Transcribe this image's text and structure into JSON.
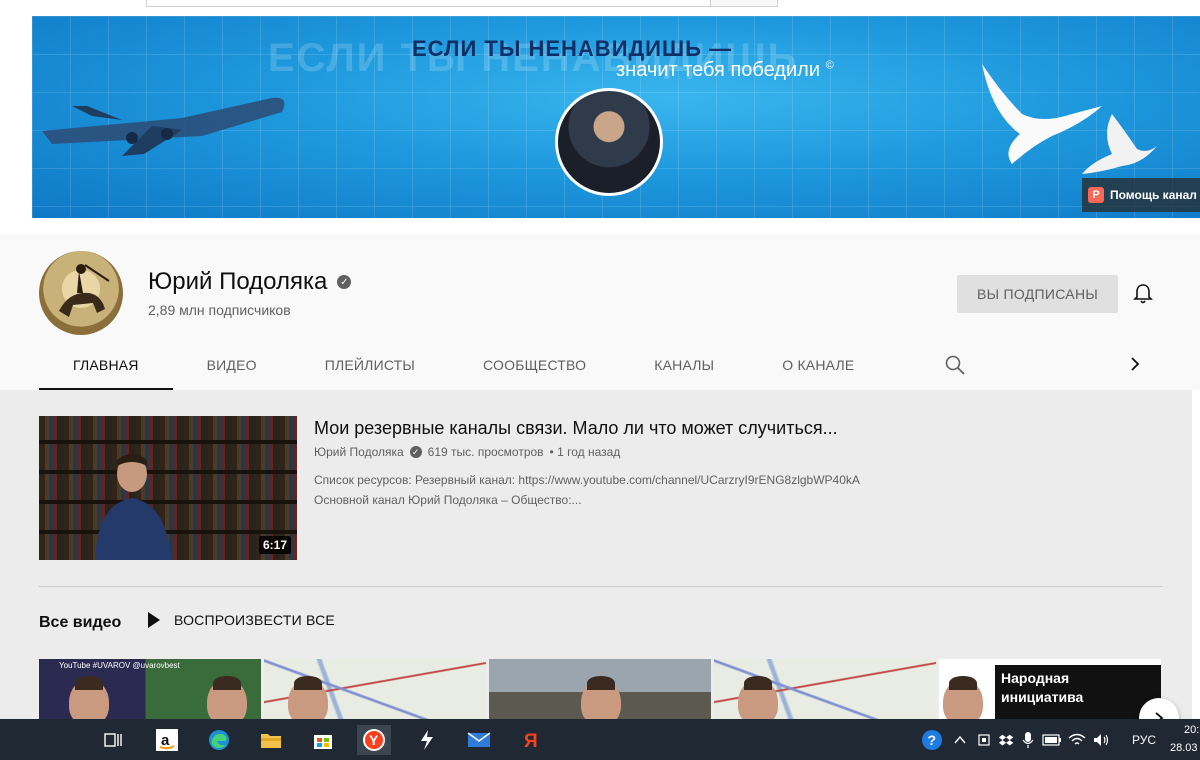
{
  "banner": {
    "ghost_text": "ЕСЛИ ТЫ НЕНАВИДИШЬ",
    "slogan_line1": "ЕСЛИ ТЫ НЕНАВИДИШЬ —",
    "slogan_line2": "значит тебя победили",
    "copyright": "©",
    "help_label": "Помощь канал"
  },
  "channel": {
    "name": "Юрий Подоляка",
    "subscribers": "2,89 млн подписчиков",
    "subscribed_label": "ВЫ ПОДПИСАНЫ"
  },
  "tabs": [
    {
      "label": "ГЛАВНАЯ",
      "active": true
    },
    {
      "label": "ВИДЕО"
    },
    {
      "label": "ПЛЕЙЛИСТЫ"
    },
    {
      "label": "СООБЩЕСТВО"
    },
    {
      "label": "КАНАЛЫ"
    },
    {
      "label": "О КАНАЛЕ"
    }
  ],
  "featured_video": {
    "title": "Мои резервные каналы связи. Мало ли что может случиться...",
    "channel": "Юрий Подоляка",
    "views": "619 тыс. просмотров",
    "age": "• 1 год назад",
    "description_line1": "Список ресурсов: Резервный канал: https://www.youtube.com/channel/UCarzryI9rENG8zlgbWP40kA",
    "description_line2": "Основной канал Юрий Подоляка – Общество:...",
    "duration": "6:17"
  },
  "videos_section": {
    "title": "Все видео",
    "play_all_label": "ВОСПРОИЗВЕСТИ ВСЕ",
    "thumb1_caption": "YouTube #UVAROV @uvarovbest",
    "thumb5_caption_line1": "Народная",
    "thumb5_caption_line2": "инициатива"
  },
  "taskbar": {
    "language": "РУС",
    "time": "20:",
    "date": "28.03"
  },
  "colors": {
    "banner_blue": "#1e98dd",
    "subscribed_bg": "#e0e0e0",
    "taskbar_bg": "#1f2833",
    "yandex_red": "#fc3f1d"
  }
}
